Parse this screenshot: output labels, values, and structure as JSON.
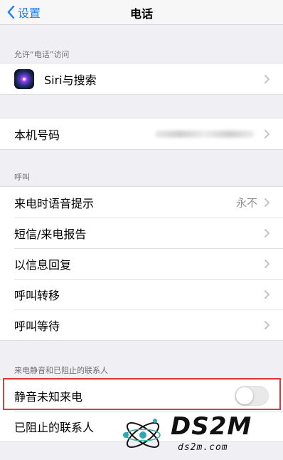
{
  "nav": {
    "back_label": "设置",
    "title": "电话"
  },
  "sections": {
    "allow_access": {
      "header": "允许“电话”访问",
      "siri_label": "Siri与搜索"
    },
    "my_number": {
      "label": "本机号码"
    },
    "calls": {
      "header": "呼叫",
      "announce_label": "来电时语音提示",
      "announce_value": "永不",
      "sms_report_label": "短信/来电报告",
      "reply_with_message_label": "以信息回复",
      "call_forwarding_label": "呼叫转移",
      "call_waiting_label": "呼叫等待"
    },
    "silence": {
      "header": "来电静音和已阻止的联系人",
      "silence_unknown_label": "静音未知来电",
      "silence_unknown_on": false,
      "blocked_contacts_label": "已阻止的联系人"
    }
  },
  "watermark": {
    "big": "DS2M",
    "small": "ds2m.com"
  },
  "colors": {
    "accent": "#1a7cf5",
    "highlight": "#e03a3a",
    "background": "#efeff4"
  }
}
